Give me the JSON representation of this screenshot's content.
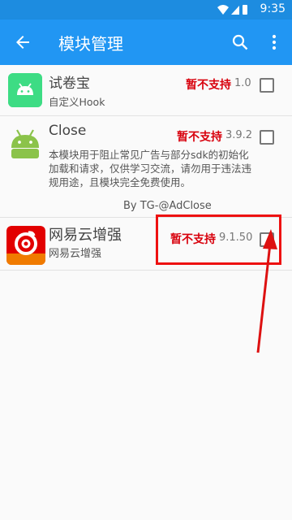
{
  "status_bar": {
    "time": "9:35",
    "icons": [
      "wifi-icon",
      "cellular-signal-icon",
      "battery-icon"
    ]
  },
  "app_bar": {
    "title": "模块管理",
    "icons": [
      "back-arrow-icon",
      "search-icon",
      "more-vertical-icon"
    ],
    "color": "#2196f3"
  },
  "modules": [
    {
      "name": "试卷宝",
      "description": "自定义Hook",
      "status": "暂不支持",
      "version": "1.0",
      "icon": "android-icon",
      "checked": false
    },
    {
      "name": "Close",
      "description": "本模块用于阻止常见广告与部分sdk的初始化加载和请求，仅供学习交流，请勿用于违法违规用途，且模块完全免费使用。",
      "author": "By TG-@AdClose",
      "status": "暂不支持",
      "version": "3.9.2",
      "icon": "android-icon",
      "checked": false
    },
    {
      "name": "网易云增强",
      "description": "网易云增强",
      "status": "暂不支持",
      "version": "9.1.50",
      "icon": "netease-cloud-music-icon",
      "checked": false
    }
  ],
  "annotation": {
    "highlight_color": "#e11111",
    "marks": [
      "highlight-box",
      "pointer-arrow"
    ]
  }
}
